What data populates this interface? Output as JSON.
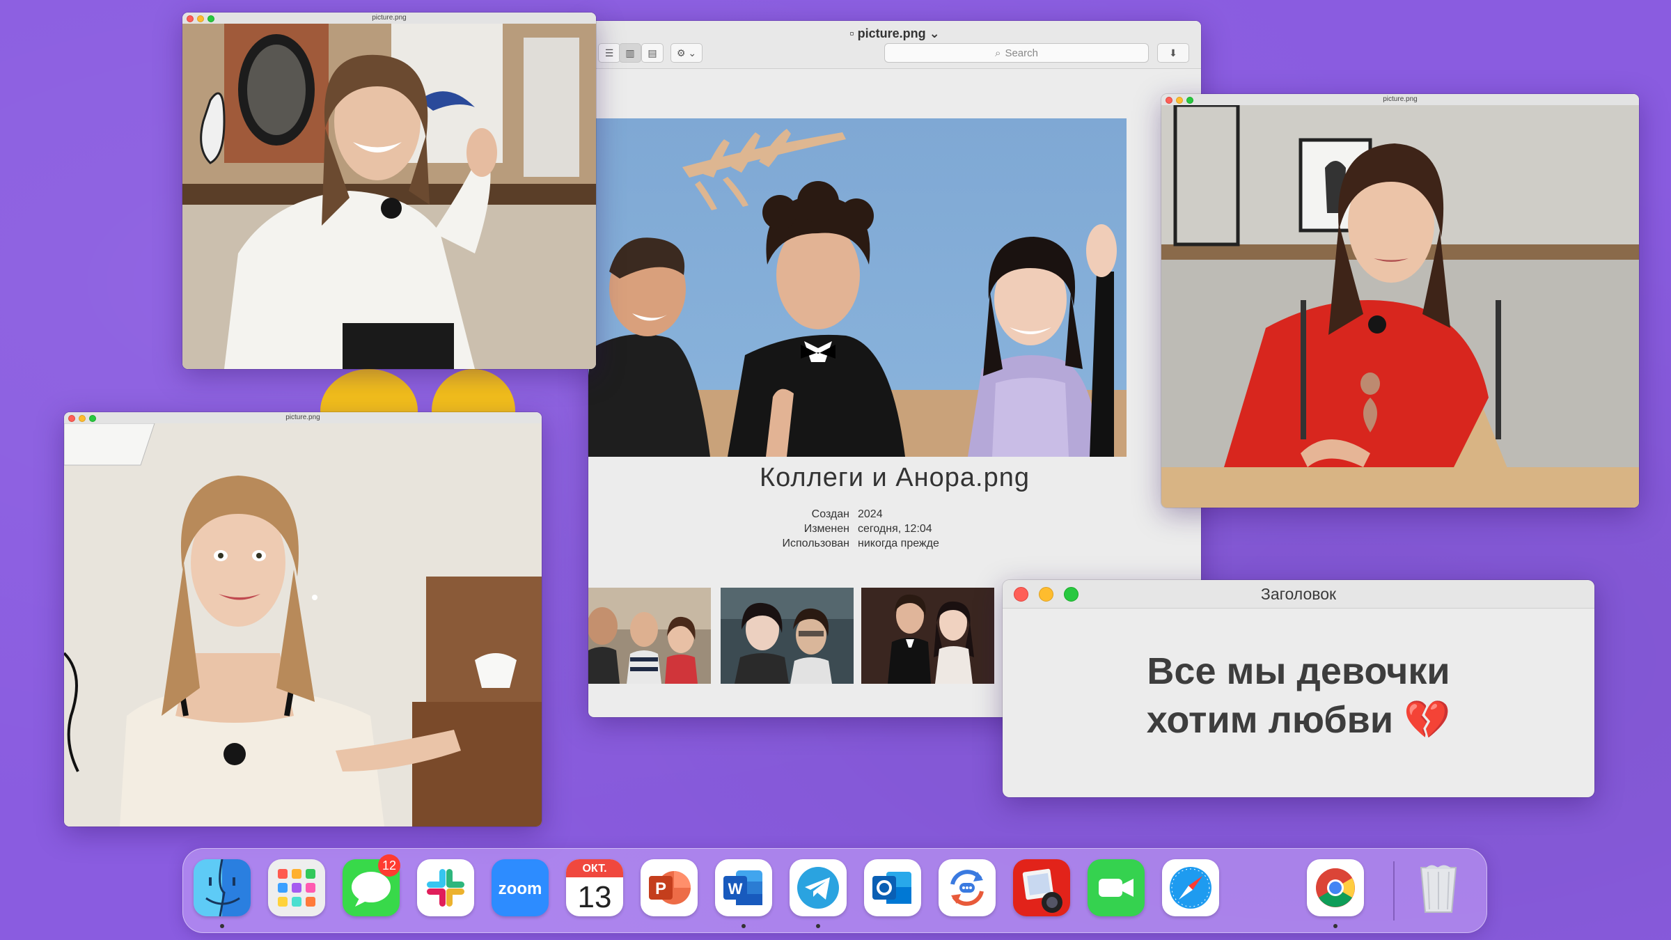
{
  "main_window": {
    "title": "picture.png",
    "search_placeholder": "Search",
    "file_name": "Коллеги и Анора.png",
    "metadata": [
      {
        "label": "Создан",
        "value": "2024"
      },
      {
        "label": "Изменен",
        "value": "сегодня, 12:04"
      },
      {
        "label": "Использован",
        "value": "никогда прежде"
      }
    ]
  },
  "windows": {
    "top_left": {
      "title": "picture.png"
    },
    "right": {
      "title": "picture.png"
    },
    "bottom_left": {
      "title": "picture.png"
    }
  },
  "dialog": {
    "title": "Заголовок",
    "body_line1": "Все мы девочки",
    "body_line2": "хотим любви 💔"
  },
  "dock": {
    "apps": [
      "finder",
      "launchpad",
      "messages",
      "slack",
      "zoom",
      "calendar",
      "powerpoint",
      "word",
      "telegram",
      "outlook",
      "screen-sharing",
      "photo-booth",
      "facetime",
      "safari",
      "chrome",
      "trash"
    ],
    "messages_badge": "12",
    "zoom_label": "zoom",
    "calendar_month": "ОКТ.",
    "calendar_day": "13"
  },
  "colors": {
    "background": "#8a5ce0",
    "traffic_red": "#fe5f57",
    "traffic_yellow": "#febc2e",
    "traffic_green": "#28c840"
  }
}
